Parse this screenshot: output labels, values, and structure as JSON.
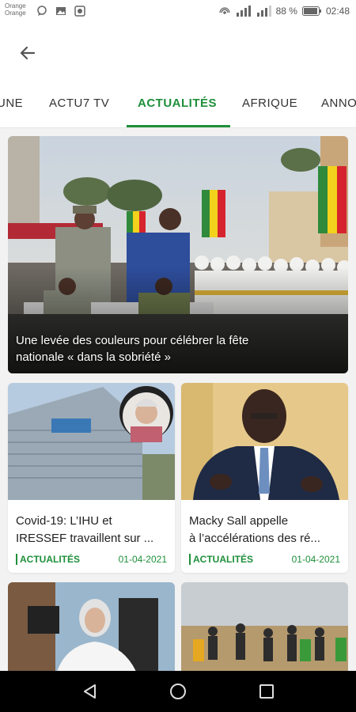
{
  "status_bar": {
    "carrier_1": "Orange",
    "carrier_2": "Orange",
    "battery": "88 %",
    "time": "02:48"
  },
  "tabs": [
    {
      "label": "UNE"
    },
    {
      "label": "ACTU7 TV"
    },
    {
      "label": "ACTUALITÉS",
      "active": true
    },
    {
      "label": "AFRIQUE"
    },
    {
      "label": "ANNO"
    }
  ],
  "hero": {
    "title_line1": "Une levée des couleurs pour célébrer la fête",
    "title_line2": "nationale « dans la sobriété »"
  },
  "cards": [
    {
      "title_line1": "Covid-19: L’IHU et",
      "title_line2": "IRESSEF travaillent sur ...",
      "category": "ACTUALITÉS",
      "date": "01-04-2021"
    },
    {
      "title_line1": "Macky Sall appelle",
      "title_line2": "à l’accélérations des ré...",
      "category": "ACTUALITÉS",
      "date": "01-04-2021"
    }
  ],
  "colors": {
    "accent": "#1e8f3a",
    "feed_background": "#f2f2f2"
  }
}
